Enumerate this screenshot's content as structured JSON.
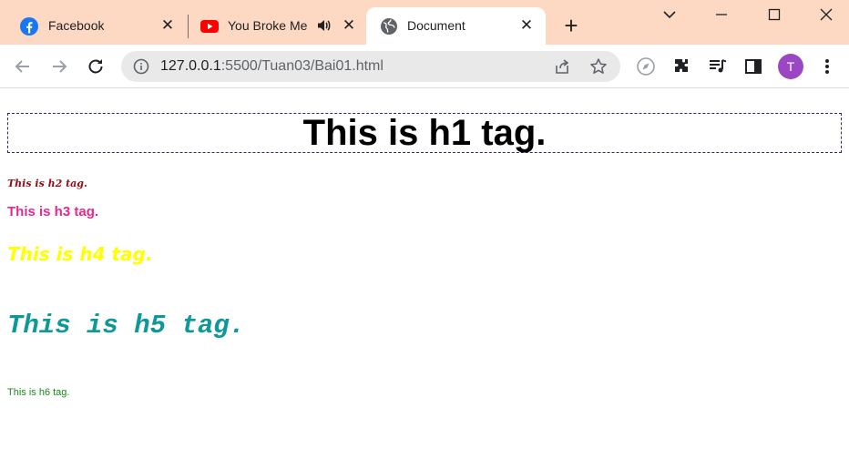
{
  "browser": {
    "tabs": [
      {
        "title": "Facebook",
        "icon": "facebook-icon",
        "active": false
      },
      {
        "title": "You Broke Me First",
        "icon": "youtube-icon",
        "active": false,
        "audio": true
      },
      {
        "title": "Document",
        "icon": "globe-icon",
        "active": true
      }
    ],
    "new_tab_label": "+",
    "address": {
      "host": "127.0.0.1",
      "path": ":5500/Tuan03/Bai01.html"
    },
    "profile_initial": "T",
    "colors": {
      "tabstrip": "#fdd9c4",
      "omnibox": "#e9e9ea",
      "avatar": "#9b46c2"
    }
  },
  "page": {
    "h1": "This is h1 tag.",
    "h2": "This is h2 tag.",
    "h3": "This is h3 tag.",
    "h4": "This is h4 tag.",
    "h5": "This is h5 tag.",
    "h6": "This is h6 tag.",
    "colors": {
      "h1": "#000000",
      "h2": "#9b0a14",
      "h3": "#e6288e",
      "h4": "#ffff00",
      "h5": "#0f9898",
      "h6": "#1a8a1a",
      "h1_border": "#2a2a7a"
    }
  }
}
